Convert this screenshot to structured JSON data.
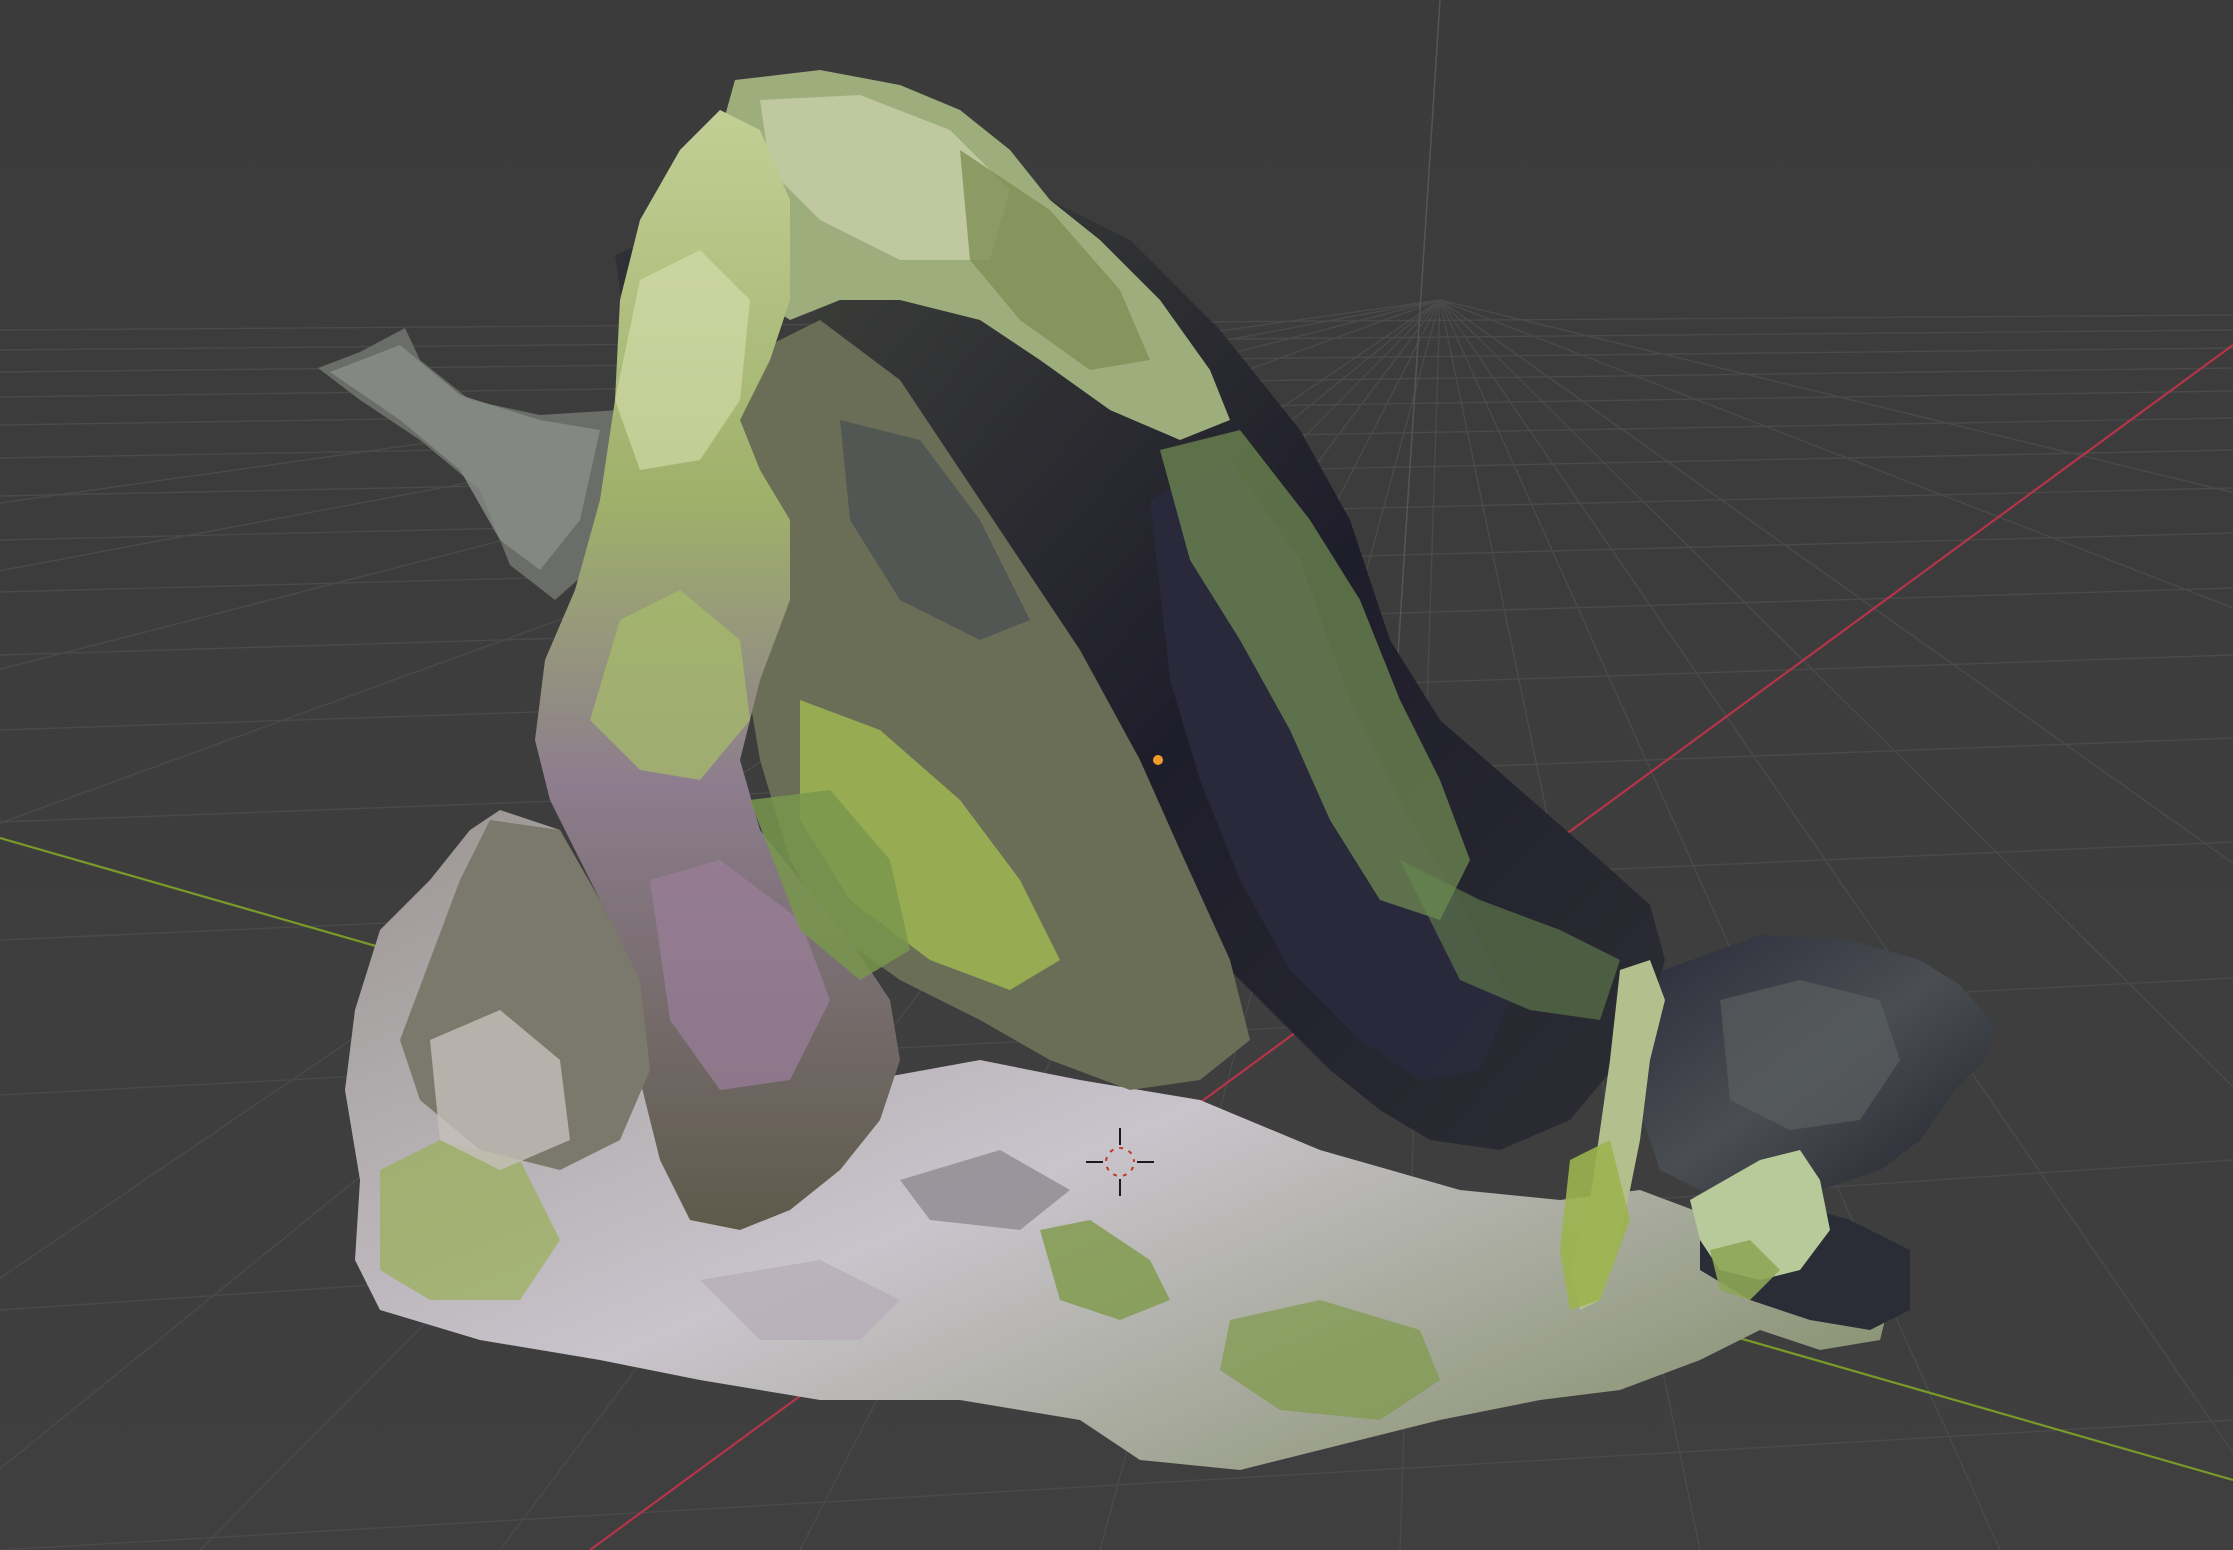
{
  "viewport": {
    "mode": "3D viewport",
    "shading": "textured",
    "background_color": "#3d3d3d",
    "grid_color": "#4a4a4a",
    "x_axis_color": "#b5344a",
    "y_axis_color": "#7a9a2a",
    "z_axis_color": "#5a5a5a"
  },
  "scene": {
    "object": "photogrammetry-rock-mesh",
    "origin_marker_color": "#f29a2e",
    "cursor_icon": "3d-cursor-icon"
  }
}
